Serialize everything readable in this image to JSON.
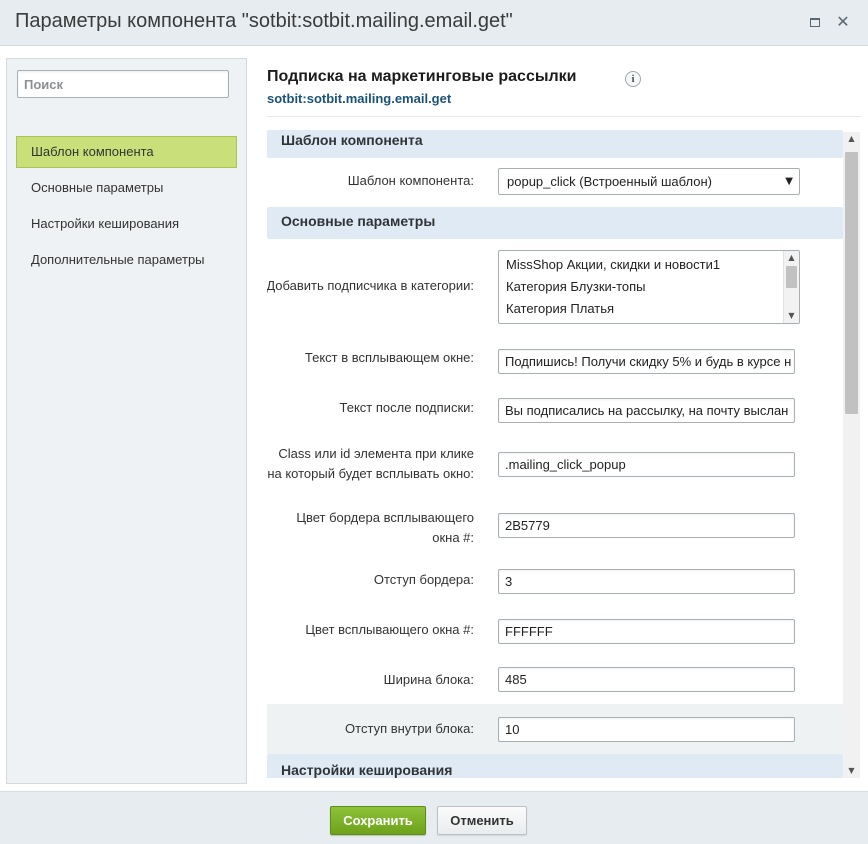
{
  "window": {
    "title": "Параметры компонента \"sotbit:sotbit.mailing.email.get\""
  },
  "sidebar": {
    "search_placeholder": "Поиск",
    "items": [
      {
        "label": "Шаблон компонента",
        "active": true
      },
      {
        "label": "Основные параметры",
        "active": false
      },
      {
        "label": "Настройки кеширования",
        "active": false
      },
      {
        "label": "Дополнительные параметры",
        "active": false
      }
    ]
  },
  "main": {
    "title": "Подписка на маркетинговые рассылки",
    "info_icon": "i",
    "subtitle": "sotbit:sotbit.mailing.email.get"
  },
  "sections": {
    "template": {
      "header": "Шаблон компонента",
      "template_label": "Шаблон компонента:",
      "template_value": "popup_click (Встроенный шаблон)"
    },
    "basic": {
      "header": "Основные параметры",
      "categories_label": "Добавить подписчика в категории:",
      "categories": [
        "MissShop Акции, скидки и новости1",
        "Категория Блузки-топы",
        "Категория Платья"
      ],
      "popup_text_label": "Текст в всплывающем окне:",
      "popup_text_value": "Подпишись! Получи скидку 5% и будь в курсе н",
      "after_text_label": "Текст после подписки:",
      "after_text_value": "Вы подписались на рассылку, на почту выслан",
      "class_label_line1": "Class или id элемента при клике",
      "class_label_line2": "на который будет всплывать окно:",
      "class_value": ".mailing_click_popup",
      "border_color_label_line1": "Цвет бордера всплывающего",
      "border_color_label_line2": "окна #:",
      "border_color_value": "2B5779",
      "border_offset_label": "Отступ бордера:",
      "border_offset_value": "3",
      "popup_color_label": "Цвет всплывающего окна #:",
      "popup_color_value": "FFFFFF",
      "width_label": "Ширина блока:",
      "width_value": "485",
      "padding_label": "Отступ внутри блока:",
      "padding_value": "10"
    },
    "cache": {
      "header": "Настройки кеширования"
    }
  },
  "footer": {
    "save_label": "Сохранить",
    "cancel_label": "Отменить"
  },
  "colors": {
    "active_nav": "#c9e07a",
    "section_header": "#e0eaf5",
    "save_button": "#7ab12a",
    "subtitle_link": "#1a5378"
  },
  "icons": {
    "maximize": "maximize-icon",
    "close": "close-icon",
    "info": "info-icon",
    "dropdown": "chevron-down-icon"
  }
}
